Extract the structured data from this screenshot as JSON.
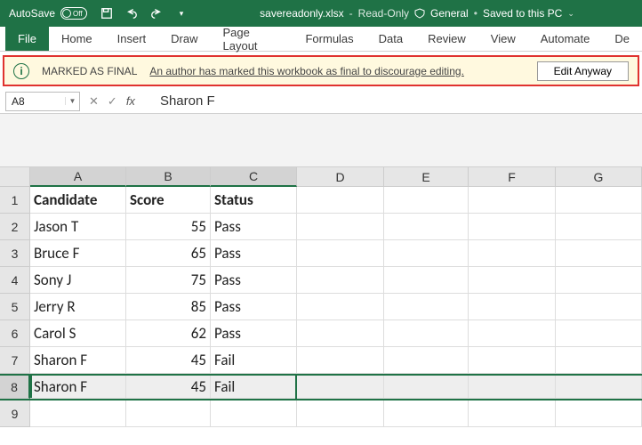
{
  "title": {
    "autosave": "AutoSave",
    "off": "Off",
    "filename": "savereadonly.xlsx",
    "readonly": "Read-Only",
    "classification": "General",
    "saved": "Saved to this PC"
  },
  "ribbon": {
    "file": "File",
    "home": "Home",
    "insert": "Insert",
    "draw": "Draw",
    "pagelayout": "Page Layout",
    "formulas": "Formulas",
    "data": "Data",
    "review": "Review",
    "view": "View",
    "automate": "Automate",
    "dev": "De"
  },
  "msgbar": {
    "info": "i",
    "strong": "MARKED AS FINAL",
    "desc": "An author has marked this workbook as final to discourage editing.",
    "edit": "Edit Anyway"
  },
  "formulabar": {
    "namebox": "A8",
    "fx": "fx",
    "value": "Sharon F"
  },
  "cols": [
    "A",
    "B",
    "C",
    "D",
    "E",
    "F",
    "G"
  ],
  "headers": {
    "a": "Candidate",
    "b": "Score",
    "c": "Status"
  },
  "rows": [
    {
      "n": "2",
      "a": "Jason T",
      "b": "55",
      "c": "Pass"
    },
    {
      "n": "3",
      "a": "Bruce F",
      "b": "65",
      "c": "Pass"
    },
    {
      "n": "4",
      "a": "Sony J",
      "b": "75",
      "c": "Pass"
    },
    {
      "n": "5",
      "a": "Jerry R",
      "b": "85",
      "c": "Pass"
    },
    {
      "n": "6",
      "a": "Carol S",
      "b": "62",
      "c": "Pass"
    },
    {
      "n": "7",
      "a": "Sharon F",
      "b": "45",
      "c": "Fail"
    },
    {
      "n": "8",
      "a": "Sharon F",
      "b": "45",
      "c": "Fail"
    }
  ],
  "fxbtns": {
    "cancel": "✕",
    "confirm": "✓"
  }
}
